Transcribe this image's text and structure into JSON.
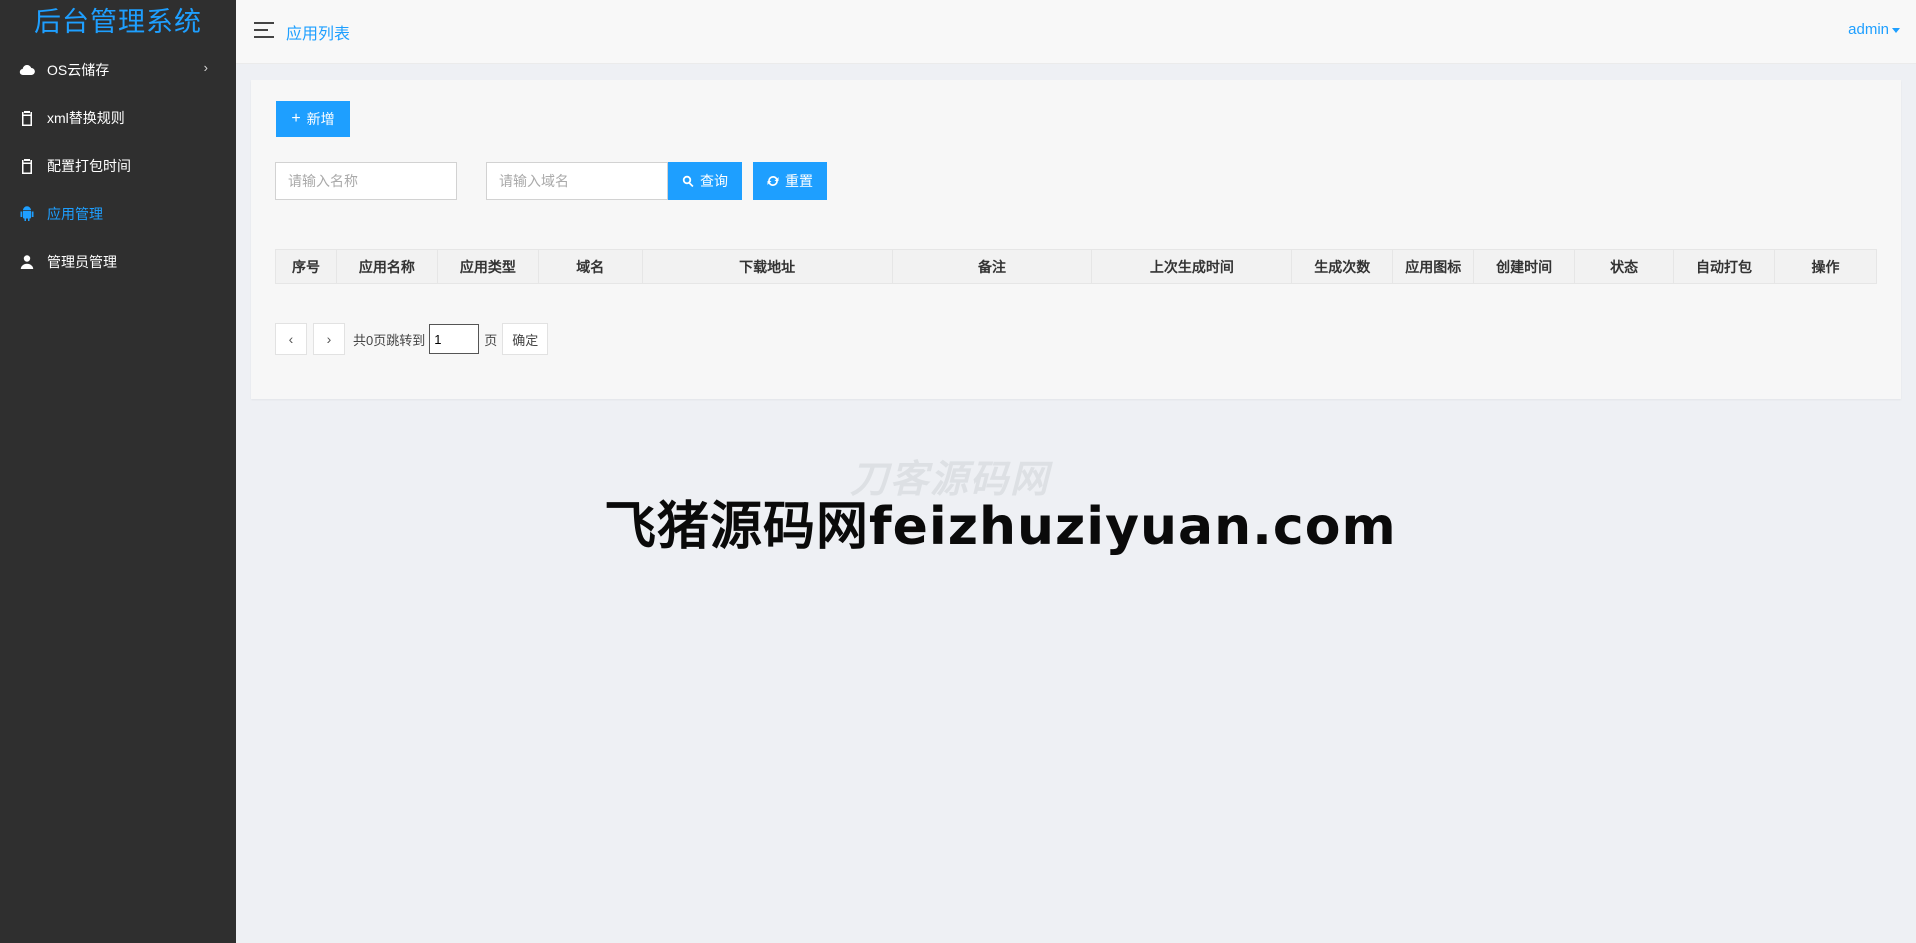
{
  "brand": {
    "title": "后台管理系统"
  },
  "sidebar": {
    "items": [
      {
        "label": "OS云储存",
        "icon": "cloud-icon",
        "has_arrow": true,
        "arrow": "›"
      },
      {
        "label": "xml替换规则",
        "icon": "clipboard-icon"
      },
      {
        "label": "配置打包时间",
        "icon": "clipboard-icon"
      },
      {
        "label": "应用管理",
        "icon": "android-icon",
        "active": true
      },
      {
        "label": "管理员管理",
        "icon": "user-icon"
      }
    ]
  },
  "header": {
    "title": "应用列表",
    "user": "admin"
  },
  "toolbar": {
    "add_label": "新增",
    "add_symbol": "+"
  },
  "search": {
    "name_placeholder": "请输入名称",
    "domain_placeholder": "请输入域名",
    "search_label": "查询",
    "reset_label": "重置"
  },
  "table": {
    "columns": [
      "序号",
      "应用名称",
      "应用类型",
      "域名",
      "下载地址",
      "备注",
      "上次生成时间",
      "生成次数",
      "应用图标",
      "创建时间",
      "状态",
      "自动打包",
      "操作"
    ]
  },
  "pager": {
    "prev": "‹",
    "next": "›",
    "total_text": "共0页跳转到",
    "page_value": "1",
    "unit": "页",
    "confirm": "确定"
  },
  "watermark": {
    "main": "飞猪源码网feizhuziyuan.com",
    "faint": "刀客源码网"
  },
  "colors": {
    "accent": "#1e9fff",
    "sidebar_bg": "#2f2f2f",
    "page_bg": "#eef0f4"
  }
}
